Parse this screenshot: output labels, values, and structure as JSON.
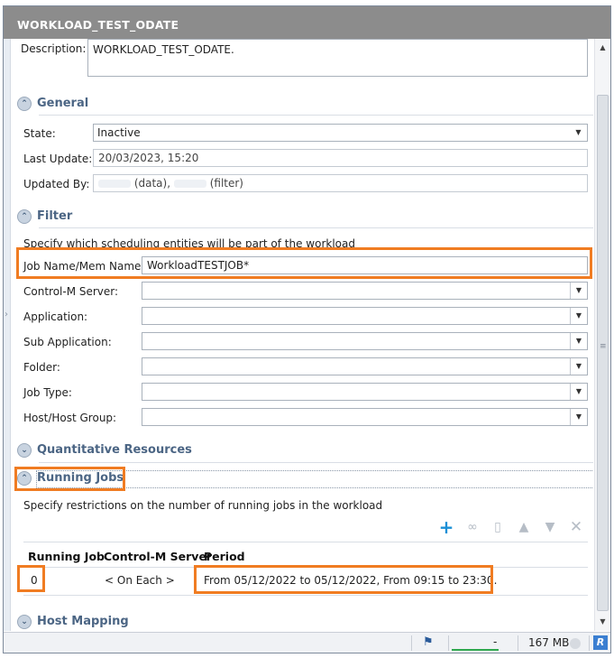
{
  "window": {
    "title": "WORKLOAD_TEST_ODATE"
  },
  "description": {
    "label": "Description:",
    "value": "WORKLOAD_TEST_ODATE."
  },
  "general": {
    "title": "General",
    "state_label": "State:",
    "state_value": "Inactive",
    "last_update_label": "Last Update:",
    "last_update_value": "20/03/2023, 15:20",
    "updated_by_label": "Updated By:",
    "updated_by_data": "(data),",
    "updated_by_filter": "(filter)"
  },
  "filter": {
    "title": "Filter",
    "hint": "Specify which scheduling entities will be part of the workload",
    "job_name_label": "Job Name/Mem Name:",
    "job_name_value": "WorkloadTESTJOB*",
    "fields": [
      {
        "label": "Control-M Server:",
        "value": ""
      },
      {
        "label": "Application:",
        "value": ""
      },
      {
        "label": "Sub Application:",
        "value": ""
      },
      {
        "label": "Folder:",
        "value": ""
      },
      {
        "label": "Job Type:",
        "value": ""
      },
      {
        "label": "Host/Host Group:",
        "value": ""
      }
    ]
  },
  "quantitative": {
    "title": "Quantitative Resources"
  },
  "running_jobs": {
    "title": "Running Jobs",
    "hint": "Specify restrictions on the number of running jobs in the workload",
    "toolbar_icons": [
      "add-icon",
      "link-icon",
      "properties-icon",
      "move-up-icon",
      "move-down-icon",
      "delete-icon"
    ],
    "columns": [
      "Running Job",
      "Control-M Server",
      "Period"
    ],
    "rows": [
      {
        "running_job": "0",
        "server": "< On Each >",
        "period": "From 05/12/2022 to 05/12/2022, From 09:15 to 23:30."
      }
    ]
  },
  "host_mapping": {
    "title": "Host Mapping"
  },
  "status": {
    "dash": "-",
    "memory": "167 MB",
    "badge": "R"
  },
  "colors": {
    "highlight": "#f07c22",
    "titlebar": "#8c8c8c",
    "section_title": "#4b6584",
    "add_icon": "#1a8fd6"
  }
}
